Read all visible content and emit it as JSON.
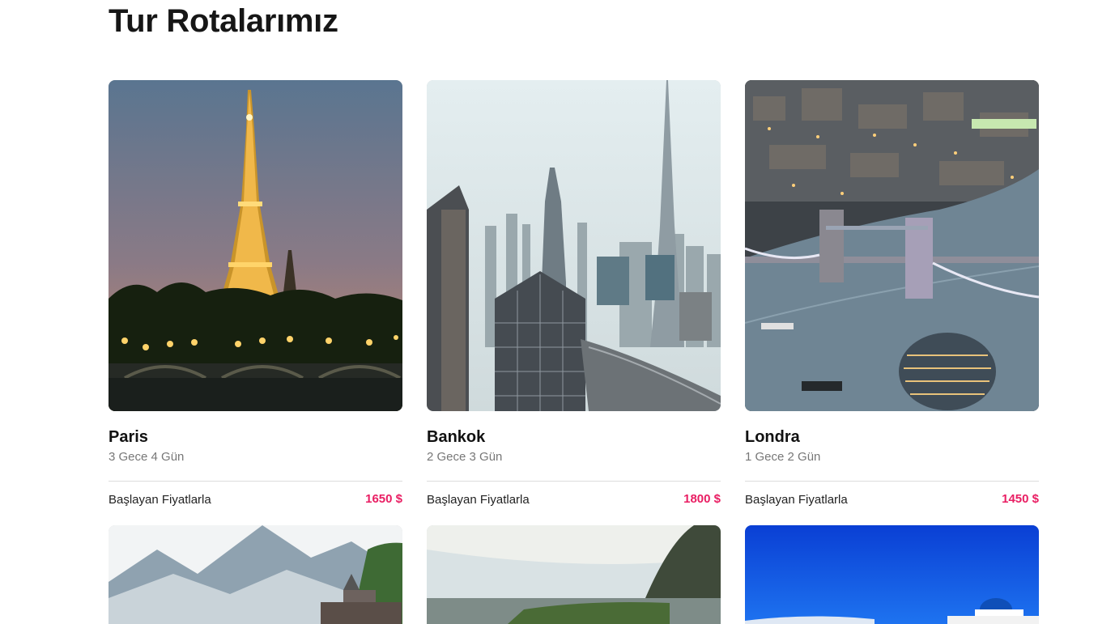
{
  "page": {
    "title": "Tur Rotalarımız"
  },
  "accent_color": "#e91e63",
  "tours": [
    {
      "city": "Paris",
      "duration": "3 Gece 4 Gün",
      "price_label": "Başlayan Fiyatlarla",
      "price": "1650 $",
      "image": "eiffel-tower-photo"
    },
    {
      "city": "Bankok",
      "duration": "2 Gece 3 Gün",
      "price_label": "Başlayan Fiyatlarla",
      "price": "1800 $",
      "image": "skyline-photo"
    },
    {
      "city": "Londra",
      "duration": "1 Gece 2 Gün",
      "price_label": "Başlayan Fiyatlarla",
      "price": "1450 $",
      "image": "tower-bridge-photo"
    }
  ],
  "more_tours": [
    {
      "image": "misty-mountains-photo"
    },
    {
      "image": "coast-mountain-photo"
    },
    {
      "image": "santorini-photo"
    }
  ]
}
